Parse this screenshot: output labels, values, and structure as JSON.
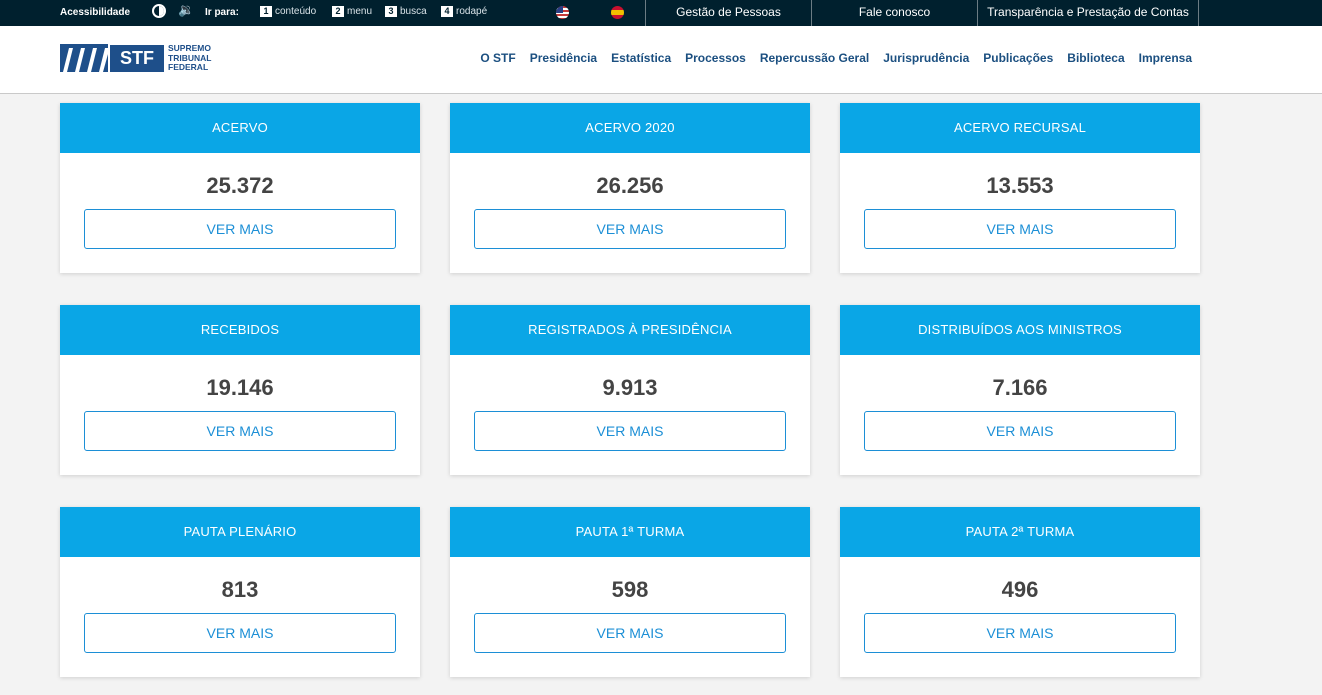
{
  "topbar": {
    "accessibility_label": "Acessibilidade",
    "goto_label": "Ir para:",
    "shortcuts": [
      {
        "num": "1",
        "label": "conteúdo"
      },
      {
        "num": "2",
        "label": "menu"
      },
      {
        "num": "3",
        "label": "busca"
      },
      {
        "num": "4",
        "label": "rodapé"
      }
    ],
    "links": [
      "Gestão de Pessoas",
      "Fale conosco",
      "Transparência e Prestação de Contas"
    ]
  },
  "header": {
    "logo_text": "STF",
    "logo_name": [
      "SUPREMO",
      "TRIBUNAL",
      "FEDERAL"
    ],
    "nav": [
      "O STF",
      "Presidência",
      "Estatística",
      "Processos",
      "Repercussão Geral",
      "Jurisprudência",
      "Publicações",
      "Biblioteca",
      "Imprensa"
    ]
  },
  "cards": [
    {
      "title": "ACERVO",
      "value": "25.372",
      "button": "VER MAIS"
    },
    {
      "title": "ACERVO 2020",
      "value": "26.256",
      "button": "VER MAIS"
    },
    {
      "title": "ACERVO RECURSAL",
      "value": "13.553",
      "button": "VER MAIS"
    },
    {
      "title": "RECEBIDOS",
      "value": "19.146",
      "button": "VER MAIS"
    },
    {
      "title": "REGISTRADOS À PRESIDÊNCIA",
      "value": "9.913",
      "button": "VER MAIS"
    },
    {
      "title": "DISTRIBUÍDOS AOS MINISTROS",
      "value": "7.166",
      "button": "VER MAIS"
    },
    {
      "title": "PAUTA PLENÁRIO",
      "value": "813",
      "button": "VER MAIS"
    },
    {
      "title": "PAUTA 1ª TURMA",
      "value": "598",
      "button": "VER MAIS"
    },
    {
      "title": "PAUTA 2ª TURMA",
      "value": "496",
      "button": "VER MAIS"
    }
  ],
  "colors": {
    "topbar": "#00202e",
    "card_header": "#0aa6e6",
    "accent": "#1c8fd6",
    "brand": "#1e4f8a"
  },
  "icons": [
    "contrast-icon",
    "audio-icon",
    "flag-us-icon",
    "flag-es-icon"
  ]
}
